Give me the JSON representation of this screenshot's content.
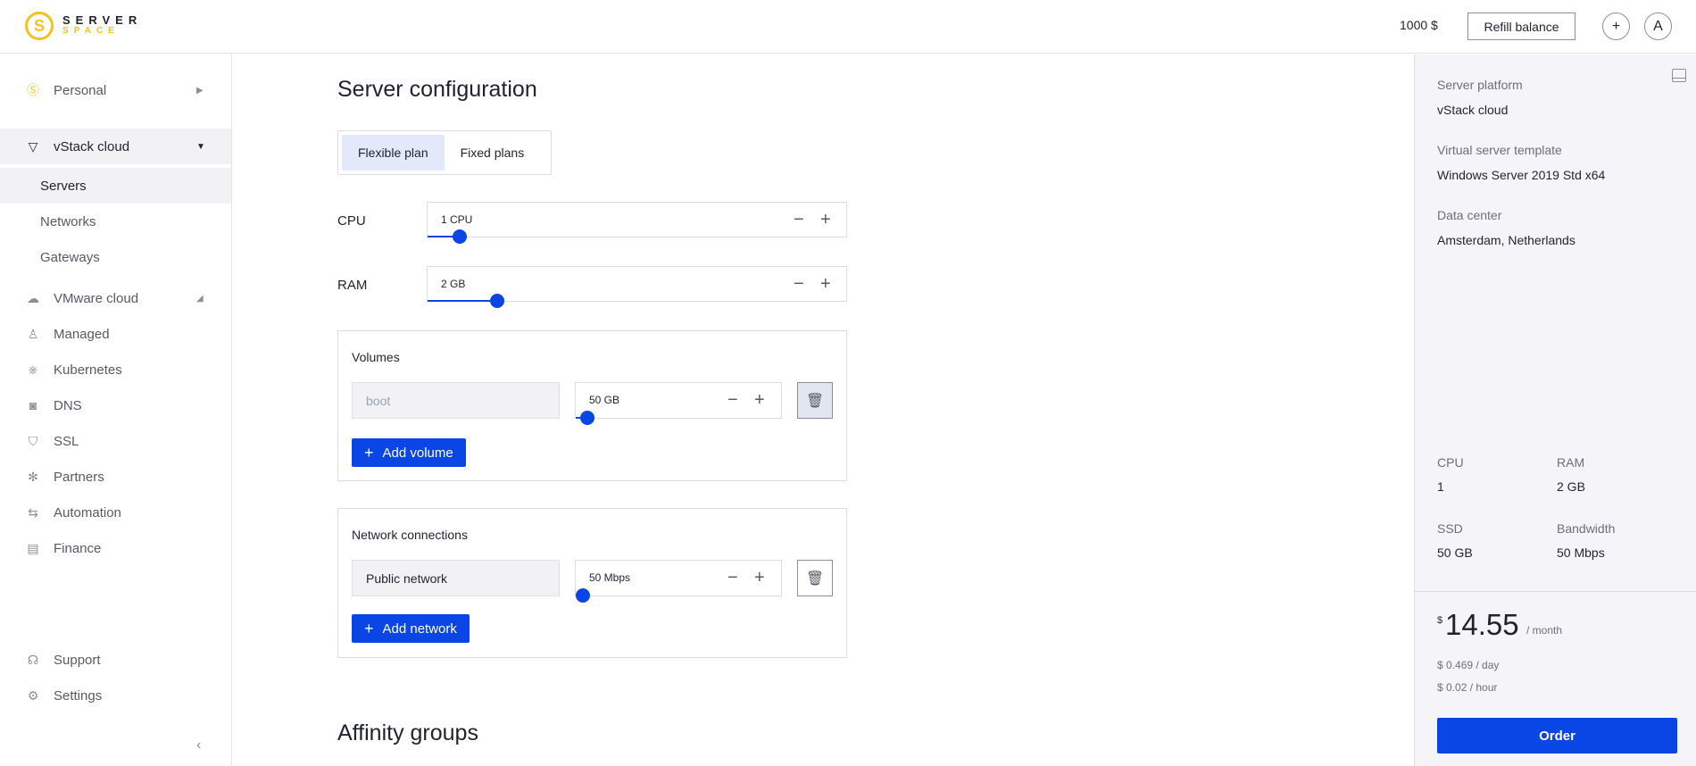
{
  "header": {
    "logo_line1": "SERVER",
    "logo_line2": "SPACE",
    "balance": "1000 $",
    "refill_label": "Refill balance",
    "add_icon": "plus-icon",
    "avatar_letter": "A"
  },
  "sidebar": {
    "groups": [
      {
        "label": "Personal",
        "icon": "serverspace-logo-icon",
        "caret": "▶"
      },
      {
        "label": "vStack cloud",
        "icon": "vstack-icon",
        "caret": "▼",
        "expanded": true,
        "children": [
          {
            "label": "Servers",
            "active": true
          },
          {
            "label": "Networks"
          },
          {
            "label": "Gateways"
          }
        ]
      },
      {
        "label": "VMware cloud",
        "icon": "cloud-icon",
        "caret": "◢"
      },
      {
        "label": "Managed",
        "icon": "managed-icon"
      },
      {
        "label": "Kubernetes",
        "icon": "kubernetes-icon"
      },
      {
        "label": "DNS",
        "icon": "dns-icon"
      },
      {
        "label": "SSL",
        "icon": "shield-icon"
      },
      {
        "label": "Partners",
        "icon": "partners-icon"
      },
      {
        "label": "Automation",
        "icon": "arrows-icon"
      },
      {
        "label": "Finance",
        "icon": "document-icon"
      }
    ],
    "bottom": [
      {
        "label": "Support",
        "icon": "headset-icon"
      },
      {
        "label": "Settings",
        "icon": "gear-icon"
      }
    ],
    "collapse_icon": "chevron-left-icon"
  },
  "main": {
    "title": "Server configuration",
    "plan_tabs": [
      {
        "label": "Flexible plan",
        "active": true
      },
      {
        "label": "Fixed plans",
        "active": false
      }
    ],
    "cpu": {
      "label": "CPU",
      "value": "1 CPU",
      "slider_fraction": 0.06
    },
    "ram": {
      "label": "RAM",
      "value": "2 GB",
      "slider_fraction": 0.15
    },
    "volumes": {
      "title": "Volumes",
      "items": [
        {
          "name_placeholder": "boot",
          "size": "50 GB",
          "slider_fraction": 0.02
        }
      ],
      "add_label": "Add volume"
    },
    "networks": {
      "title": "Network connections",
      "items": [
        {
          "name": "Public network",
          "bandwidth": "50 Mbps",
          "slider_fraction": 0.0
        }
      ],
      "add_label": "Add network"
    },
    "affinity_title": "Affinity groups"
  },
  "summary": {
    "platform_label": "Server platform",
    "platform_value": "vStack cloud",
    "template_label": "Virtual server template",
    "template_value": "Windows Server 2019 Std x64",
    "datacenter_label": "Data center",
    "datacenter_value": "Amsterdam, Netherlands",
    "specs": [
      {
        "label": "CPU",
        "value": "1"
      },
      {
        "label": "RAM",
        "value": "2 GB"
      },
      {
        "label": "SSD",
        "value": "50 GB"
      },
      {
        "label": "Bandwidth",
        "value": "50 Mbps"
      }
    ],
    "price_currency": "$",
    "price_month": "14.55",
    "price_period": "/ month",
    "price_day": "$ 0.469 / day",
    "price_hour": "$ 0.02 / hour",
    "order_label": "Order"
  },
  "colors": {
    "accent": "#0a45e6",
    "brand_yellow": "#f3c21b",
    "summary_bg": "#f5f5f9"
  }
}
